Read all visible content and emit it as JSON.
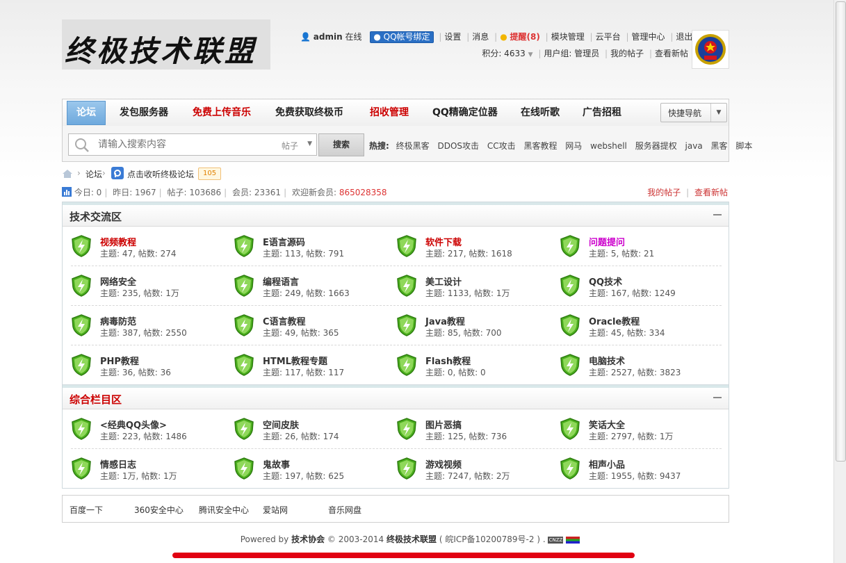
{
  "header": {
    "logo_text": "终极技术联盟",
    "username": "admin",
    "online": "在线",
    "qq_bind": "QQ帐号绑定",
    "links1": [
      "设置",
      "消息"
    ],
    "remind": "提醒(8)",
    "links2": [
      "模块管理",
      "云平台",
      "管理中心",
      "退出"
    ],
    "points": "积分: 4633",
    "usergroup": "用户组: 管理员",
    "my_posts": "我的帖子",
    "new_posts": "查看新帖"
  },
  "nav": {
    "items": [
      {
        "label": "论坛"
      },
      {
        "label": "发包服务器"
      },
      {
        "label": "免费上传音乐"
      },
      {
        "label": "免费获取终极币"
      },
      {
        "label": "招收管理"
      },
      {
        "label": "QQ精确定位器"
      },
      {
        "label": "在线听歌"
      },
      {
        "label": "广告招租"
      }
    ],
    "quick_nav": "快捷导航"
  },
  "search": {
    "placeholder": "请输入搜索内容",
    "type": "帖子",
    "button": "搜索",
    "hot_label": "热搜:",
    "hot": [
      "终极黑客",
      "DDOS攻击",
      "CC攻击",
      "黑客教程",
      "网马",
      "webshell",
      "服务器提权",
      "java",
      "黑客",
      "脚本"
    ]
  },
  "breadcrumb": {
    "sep": "›",
    "forum": "论坛",
    "radio_link": "点击收听终极论坛",
    "radio_count": "105"
  },
  "stats": {
    "today": "今日: 0",
    "yesterday": "昨日: 1967",
    "posts": "帖子: 103686",
    "members": "会员: 23361",
    "welcome": "欢迎新会员:",
    "new_member": "865028358",
    "my_posts": "我的帖子",
    "view_new": "查看新帖"
  },
  "sections": [
    {
      "title": "技术交流区",
      "title_color": "#333333",
      "forums": [
        {
          "name": "视频教程",
          "stats": "主题: 47, 帖数: 274",
          "color": "#cc0000"
        },
        {
          "name": "E语言源码",
          "stats": "主题: 113, 帖数: 791",
          "color": "#333333"
        },
        {
          "name": "软件下载",
          "stats": "主题: 217, 帖数: 1618",
          "color": "#cc0000"
        },
        {
          "name": "问题提问",
          "stats": "主题: 5, 帖数: 21",
          "color": "#cc00cc"
        },
        {
          "name": "网络安全",
          "stats": "主题: 235, 帖数: 1万",
          "color": "#333333"
        },
        {
          "name": "编程语言",
          "stats": "主题: 249, 帖数: 1663",
          "color": "#333333"
        },
        {
          "name": "美工设计",
          "stats": "主题: 1133, 帖数: 1万",
          "color": "#333333"
        },
        {
          "name": "QQ技术",
          "stats": "主题: 167, 帖数: 1249",
          "color": "#333333"
        },
        {
          "name": "病毒防范",
          "stats": "主题: 387, 帖数: 2550",
          "color": "#333333"
        },
        {
          "name": "C语言教程",
          "stats": "主题: 49, 帖数: 365",
          "color": "#333333"
        },
        {
          "name": "Java教程",
          "stats": "主题: 85, 帖数: 700",
          "color": "#333333"
        },
        {
          "name": "Oracle教程",
          "stats": "主题: 45, 帖数: 334",
          "color": "#333333"
        },
        {
          "name": "PHP教程",
          "stats": "主题: 36, 帖数: 36",
          "color": "#333333"
        },
        {
          "name": "HTML教程专题",
          "stats": "主题: 117, 帖数: 117",
          "color": "#333333"
        },
        {
          "name": "Flash教程",
          "stats": "主题: 0, 帖数: 0",
          "color": "#333333"
        },
        {
          "name": "电脑技术",
          "stats": "主题: 2527, 帖数: 3823",
          "color": "#333333"
        }
      ]
    },
    {
      "title": "综合栏目区",
      "title_color": "#cc0000",
      "forums": [
        {
          "name": "<经典QQ头像>",
          "stats": "主题: 223, 帖数: 1486",
          "color": "#333333"
        },
        {
          "name": "空间皮肤",
          "stats": "主题: 26, 帖数: 174",
          "color": "#333333"
        },
        {
          "name": "图片恶搞",
          "stats": "主题: 125, 帖数: 736",
          "color": "#333333"
        },
        {
          "name": "笑话大全",
          "stats": "主题: 2797, 帖数: 1万",
          "color": "#333333"
        },
        {
          "name": "情感日志",
          "stats": "主题: 1万, 帖数: 1万",
          "color": "#333333"
        },
        {
          "name": "鬼故事",
          "stats": "主题: 197, 帖数: 625",
          "color": "#333333"
        },
        {
          "name": "游戏视频",
          "stats": "主题: 7247, 帖数: 2万",
          "color": "#333333"
        },
        {
          "name": "相声小品",
          "stats": "主题: 1955, 帖数: 9437",
          "color": "#333333"
        }
      ]
    }
  ],
  "friend_links": [
    "百度一下",
    "360安全中心",
    "腾讯安全中心",
    "爱站网",
    "音乐网盘"
  ],
  "footer": {
    "powered": "Powered by",
    "org": "技术协会",
    "copyright": "© 2003-2014",
    "site": "终极技术联盟",
    "icp": "( 皖ICP备10200789号-2 ) .",
    "cnzz": "CNZZ"
  }
}
